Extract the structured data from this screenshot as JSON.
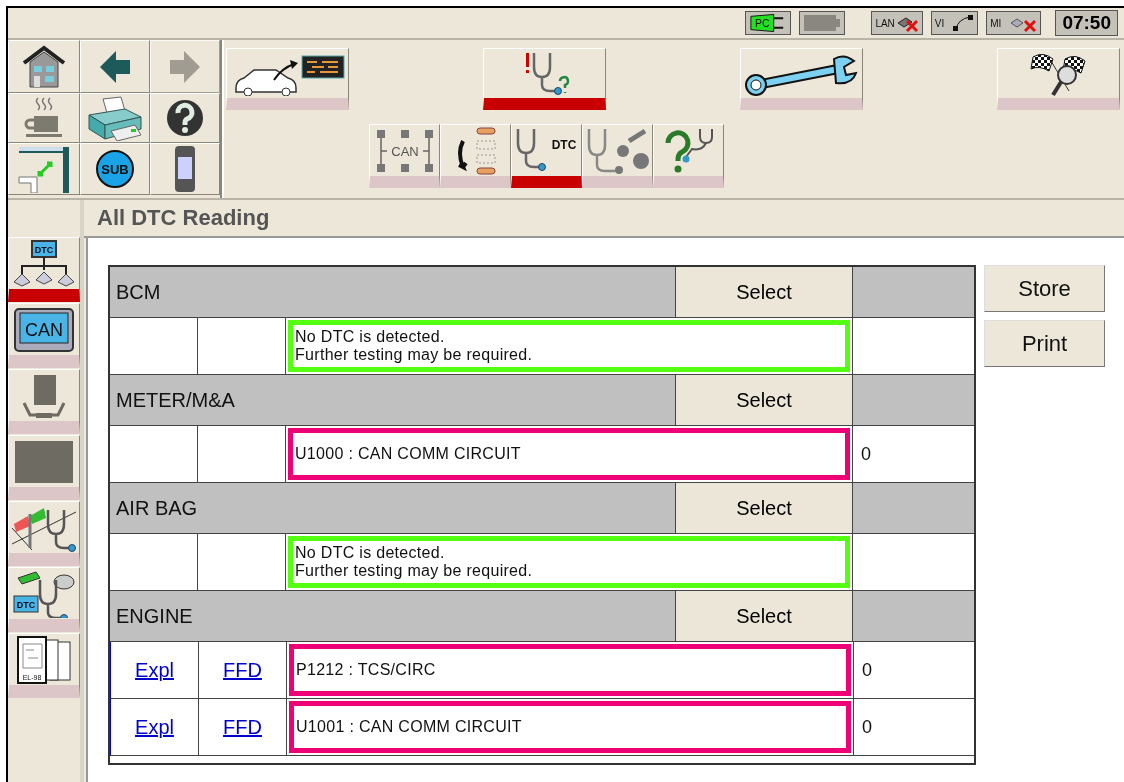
{
  "status_bar": {
    "indicators": [
      {
        "kind": "pc",
        "label": "PC",
        "error": false
      },
      {
        "kind": "battery",
        "error": false
      },
      {
        "kind": "lan",
        "label": "LAN",
        "error": true
      },
      {
        "kind": "vi",
        "label": "VI",
        "error": false
      },
      {
        "kind": "mi",
        "label": "MI",
        "error": true
      }
    ],
    "clock": "07:50"
  },
  "nav_buttons": [
    {
      "kind": "home",
      "disabled": false
    },
    {
      "kind": "back",
      "disabled": false
    },
    {
      "kind": "forward",
      "disabled": true
    },
    {
      "kind": "coffee",
      "disabled": false
    },
    {
      "kind": "print",
      "disabled": false
    },
    {
      "kind": "help",
      "disabled": false
    },
    {
      "kind": "window",
      "disabled": false
    },
    {
      "kind": "sub",
      "label": "SUB",
      "disabled": false
    },
    {
      "kind": "phone",
      "disabled": false
    }
  ],
  "mode_tabs": [
    {
      "kind": "vehicle",
      "selected": false
    },
    {
      "kind": "diagnosis",
      "selected": true
    },
    {
      "kind": "repair",
      "selected": false
    },
    {
      "kind": "flags",
      "selected": false
    }
  ],
  "sub_tabs": [
    {
      "kind": "can",
      "label": "CAN",
      "selected": false
    },
    {
      "kind": "flow",
      "selected": false
    },
    {
      "kind": "dtc",
      "label": "DTC",
      "selected": true
    },
    {
      "kind": "splatter",
      "selected": false
    },
    {
      "kind": "question",
      "selected": false
    }
  ],
  "sidebar": {
    "items": [
      {
        "kind": "network",
        "label": "DTC",
        "selected": true
      },
      {
        "kind": "can",
        "label": "CAN",
        "selected": false
      },
      {
        "kind": "seat",
        "selected": false
      },
      {
        "kind": "block",
        "selected": false
      },
      {
        "kind": "signpost",
        "selected": false
      },
      {
        "kind": "dtcscope",
        "label": "DTC",
        "selected": false
      },
      {
        "kind": "manual",
        "label": "EL-98",
        "selected": false
      }
    ]
  },
  "page_title": "All DTC Reading",
  "systems": [
    {
      "name": "BCM",
      "select_label": "Select",
      "rows": [
        {
          "fault": false,
          "message": "No DTC is detected.\nFurther testing may be required."
        }
      ]
    },
    {
      "name": "METER/M&A",
      "select_label": "Select",
      "rows": [
        {
          "fault": true,
          "message": "U1000 : CAN COMM CIRCUIT",
          "count": "0"
        }
      ]
    },
    {
      "name": "AIR BAG",
      "select_label": "Select",
      "rows": [
        {
          "fault": false,
          "message": "No DTC is detected.\nFurther testing may be required."
        }
      ]
    },
    {
      "name": "ENGINE",
      "select_label": "Select",
      "rows": [
        {
          "fault": true,
          "link_1": "Expl",
          "link_2": "FFD",
          "message": "P1212 : TCS/CIRC",
          "count": "0"
        },
        {
          "fault": true,
          "link_1": "Expl",
          "link_2": "FFD",
          "message": "U1001 : CAN COMM CIRCUIT",
          "count": "0"
        }
      ]
    }
  ],
  "buttons": [
    "Store",
    "Print"
  ]
}
